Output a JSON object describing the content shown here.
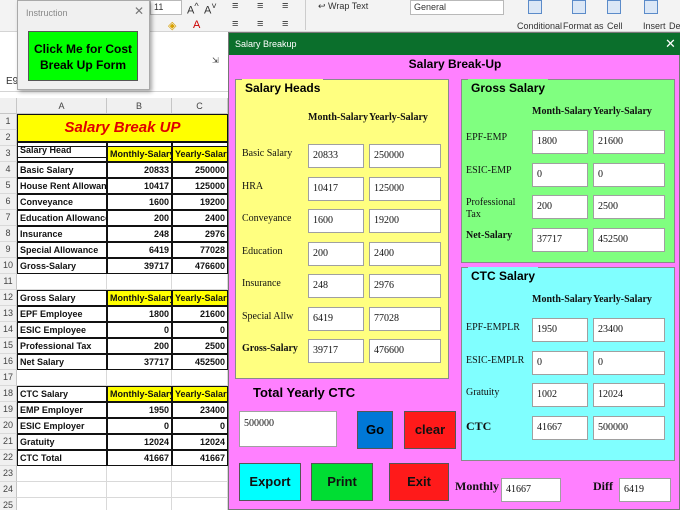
{
  "ribbon": {
    "font_size": "11",
    "wrap_text": "Wrap Text",
    "number_format": "General",
    "conditional": "Conditional",
    "format_as": "Format as",
    "cell": "Cell",
    "insert": "Insert",
    "delete": "Dele"
  },
  "name_box": "E9",
  "columns": [
    "A",
    "B",
    "C"
  ],
  "sheet": {
    "title": "Salary Break UP",
    "rows": [
      {
        "n": "1",
        "a": "",
        "b": "",
        "c": ""
      },
      {
        "n": "2",
        "a": "Salary Head",
        "b": "",
        "c": ""
      },
      {
        "n": "3",
        "a": "",
        "b": "Monthly-Salary",
        "c": "Yearly-Salary",
        "hdr": true
      },
      {
        "n": "4",
        "a": "Basic Salary",
        "b": "20833",
        "c": "250000"
      },
      {
        "n": "5",
        "a": "House Rent Allowance",
        "b": "10417",
        "c": "125000"
      },
      {
        "n": "6",
        "a": "Conveyance",
        "b": "1600",
        "c": "19200"
      },
      {
        "n": "7",
        "a": "Education Allowance",
        "b": "200",
        "c": "2400"
      },
      {
        "n": "8",
        "a": "Insurance",
        "b": "248",
        "c": "2976"
      },
      {
        "n": "9",
        "a": "Special Allowance",
        "b": "6419",
        "c": "77028"
      },
      {
        "n": "10",
        "a": "Gross-Salary",
        "b": "39717",
        "c": "476600"
      },
      {
        "n": "11",
        "a": "",
        "b": "",
        "c": ""
      },
      {
        "n": "12",
        "a": "Gross Salary",
        "b": "Monthly-Salary",
        "c": "Yearly-Salary",
        "hdr": true
      },
      {
        "n": "13",
        "a": "EPF Employee",
        "b": "1800",
        "c": "21600"
      },
      {
        "n": "14",
        "a": "ESIC Employee",
        "b": "0",
        "c": "0"
      },
      {
        "n": "15",
        "a": "Professional Tax",
        "b": "200",
        "c": "2500"
      },
      {
        "n": "16",
        "a": "Net Salary",
        "b": "37717",
        "c": "452500"
      },
      {
        "n": "17",
        "a": "",
        "b": "",
        "c": ""
      },
      {
        "n": "18",
        "a": "CTC Salary",
        "b": "Monthly-Salary",
        "c": "Yearly-Salary",
        "hdr": true
      },
      {
        "n": "19",
        "a": "EMP Employer",
        "b": "1950",
        "c": "23400"
      },
      {
        "n": "20",
        "a": "ESIC Employer",
        "b": "0",
        "c": "0"
      },
      {
        "n": "21",
        "a": "Gratuity",
        "b": "12024",
        "c": "12024"
      },
      {
        "n": "22",
        "a": "CTC Total",
        "b": "41667",
        "c": "41667"
      },
      {
        "n": "23",
        "a": "",
        "b": "",
        "c": ""
      },
      {
        "n": "24",
        "a": "",
        "b": "",
        "c": ""
      },
      {
        "n": "25",
        "a": "",
        "b": "",
        "c": ""
      }
    ]
  },
  "instruction": {
    "title": "Instruction",
    "close": "✕",
    "button": "Click Me for Cost Break Up Form"
  },
  "form": {
    "window_title": "Salary Breakup",
    "close": "✕",
    "heading": "Salary Break-Up",
    "salary_heads": {
      "label": "Salary Heads",
      "col_monthly": "Month-Salary",
      "col_yearly": "Yearly-Salary",
      "rows": [
        {
          "label": "Basic Salary",
          "monthly": "20833",
          "yearly": "250000"
        },
        {
          "label": "HRA",
          "monthly": "10417",
          "yearly": "125000"
        },
        {
          "label": "Conveyance",
          "monthly": "1600",
          "yearly": "19200"
        },
        {
          "label": "Education",
          "monthly": "200",
          "yearly": "2400"
        },
        {
          "label": "Insurance",
          "monthly": "248",
          "yearly": "2976"
        },
        {
          "label": "Special Allw",
          "monthly": "6419",
          "yearly": "77028"
        },
        {
          "label": "Gross-Salary",
          "monthly": "39717",
          "yearly": "476600"
        }
      ]
    },
    "gross_salary": {
      "label": "Gross Salary",
      "col_monthly": "Month-Salary",
      "col_yearly": "Yearly-Salary",
      "rows": [
        {
          "label": "EPF-EMP",
          "monthly": "1800",
          "yearly": "21600"
        },
        {
          "label": "ESIC-EMP",
          "monthly": "0",
          "yearly": "0"
        },
        {
          "label": "Professional Tax",
          "monthly": "200",
          "yearly": "2500"
        },
        {
          "label": "Net-Salary",
          "monthly": "37717",
          "yearly": "452500"
        }
      ]
    },
    "ctc_salary": {
      "label": "CTC Salary",
      "col_monthly": "Month-Salary",
      "col_yearly": "Yearly-Salary",
      "rows": [
        {
          "label": "EPF-EMPLR",
          "monthly": "1950",
          "yearly": "23400"
        },
        {
          "label": "ESIC-EMPLR",
          "monthly": "0",
          "yearly": "0"
        },
        {
          "label": "Gratuity",
          "monthly": "1002",
          "yearly": "12024"
        },
        {
          "label": "CTC",
          "monthly": "41667",
          "yearly": "500000"
        }
      ]
    },
    "total_ctc": {
      "label": "Total Yearly CTC",
      "value": "500000"
    },
    "buttons": {
      "go": "Go",
      "clear": "clear",
      "export": "Export",
      "print": "Print",
      "exit": "Exit"
    },
    "monthly": {
      "label": "Monthly",
      "value": "41667"
    },
    "diff": {
      "label": "Diff",
      "value": "6419"
    },
    "colors": {
      "titlebar": "#0b6f2c",
      "form_bg": "#ff80ff",
      "yellow": "#ffff80",
      "green": "#80ff80",
      "cyan": "#80ffff"
    }
  }
}
